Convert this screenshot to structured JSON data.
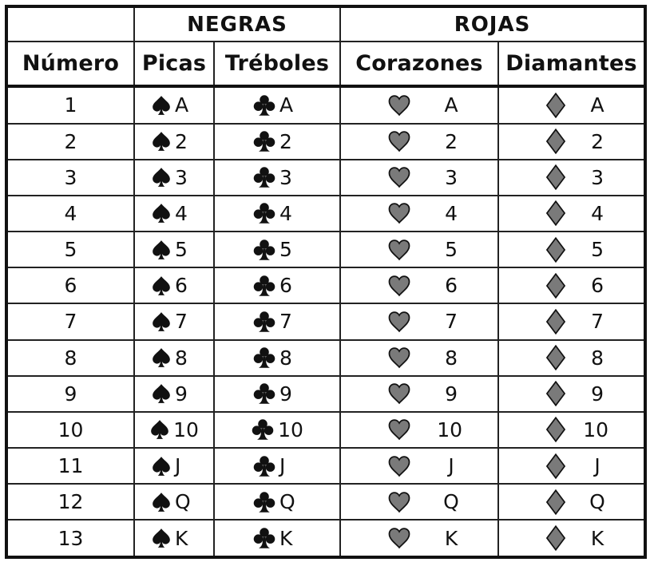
{
  "groups": {
    "black": "NEGRAS",
    "red": "ROJAS"
  },
  "columns": {
    "number": "Número",
    "spades": "Picas",
    "clubs": "Tréboles",
    "hearts": "Corazones",
    "diamonds": "Diamantes"
  },
  "ranks": [
    "A",
    "2",
    "3",
    "4",
    "5",
    "6",
    "7",
    "8",
    "9",
    "10",
    "J",
    "Q",
    "K"
  ],
  "numbers": [
    "1",
    "2",
    "3",
    "4",
    "5",
    "6",
    "7",
    "8",
    "9",
    "10",
    "11",
    "12",
    "13"
  ],
  "suits": {
    "spades": {
      "icon": "spade-icon",
      "color": "#111111"
    },
    "clubs": {
      "icon": "club-icon",
      "color": "#111111"
    },
    "hearts": {
      "icon": "heart-icon",
      "color": "#7a7a7a"
    },
    "diamonds": {
      "icon": "diamond-icon",
      "color": "#7a7a7a"
    }
  }
}
